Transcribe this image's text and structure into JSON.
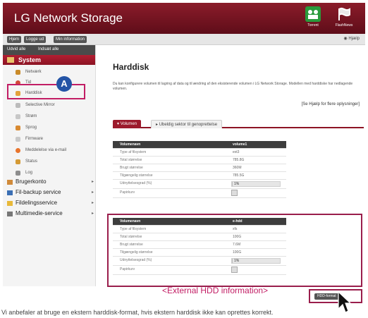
{
  "app": {
    "title": "LG Network Storage",
    "header_apps": [
      {
        "name": "Torrent"
      },
      {
        "name": "FlashNews"
      }
    ]
  },
  "topbar": {
    "home": "Hjem",
    "logout": "Logge ud",
    "my_info": "Min information",
    "help": "Hjælp"
  },
  "sidebar": {
    "expand_all": "Udvid alle",
    "collapse_all": "Indsæt alle",
    "system_label": "System",
    "system_items": [
      "Netværk",
      "Tid",
      "Harddisk",
      "Selective Mirror",
      "Strøm",
      "Sprog",
      "Firmware",
      "Meddelelse via e-mail",
      "Status",
      "Log"
    ],
    "groups": [
      "Brugerkonto",
      "Fil-backup service",
      "Fildelingsservice",
      "Multimedie-service"
    ]
  },
  "callout": "A",
  "main": {
    "title": "Harddisk",
    "description": "Du kan konfigurere volumen til lagring af data og til ændring af den eksisterende volumen i LG Network Storage. Modellen med harddiske har nedlagende volumen.",
    "help_link": "[Se Hjælp for flere oplysninger]",
    "tabs": [
      "Volumen",
      "Ubeldig sektor til genoprettelse"
    ]
  },
  "internal_volume": {
    "header": [
      "Volumenavn",
      "volume1"
    ],
    "rows": [
      {
        "label": "Type af filsystem",
        "value": "ext3"
      },
      {
        "label": "Total størrelse",
        "value": "785.8G"
      },
      {
        "label": "Brugt størrelse",
        "value": "360M"
      },
      {
        "label": "Tilgængelig størrelse",
        "value": "785.5G"
      },
      {
        "label": "Udnyttelsesgrad (%)",
        "value": "1%"
      },
      {
        "label": "Papirkurv",
        "value": ""
      }
    ]
  },
  "external_volume": {
    "header": [
      "Volumenavn",
      "e-hdd"
    ],
    "rows": [
      {
        "label": "Type af filsystem",
        "value": "xfs"
      },
      {
        "label": "Total størrelse",
        "value": "100G"
      },
      {
        "label": "Brugt størrelse",
        "value": "7.6M"
      },
      {
        "label": "Tilgængelig størrelse",
        "value": "100G"
      },
      {
        "label": "Udnyttelsesgrad (%)",
        "value": "1%"
      },
      {
        "label": "Papirkurv",
        "value": ""
      }
    ]
  },
  "external_caption": "<External HDD information>",
  "hdd_format_button": "HDD-format",
  "footer_text": "Vi anbefaler at bruge en ekstern harddisk-format, hvis ekstern harddisk ikke kan oprettes korrekt.",
  "colors": {
    "brand": "#8b1c2a",
    "highlight": "#c21d64",
    "callout": "#2454a6"
  }
}
